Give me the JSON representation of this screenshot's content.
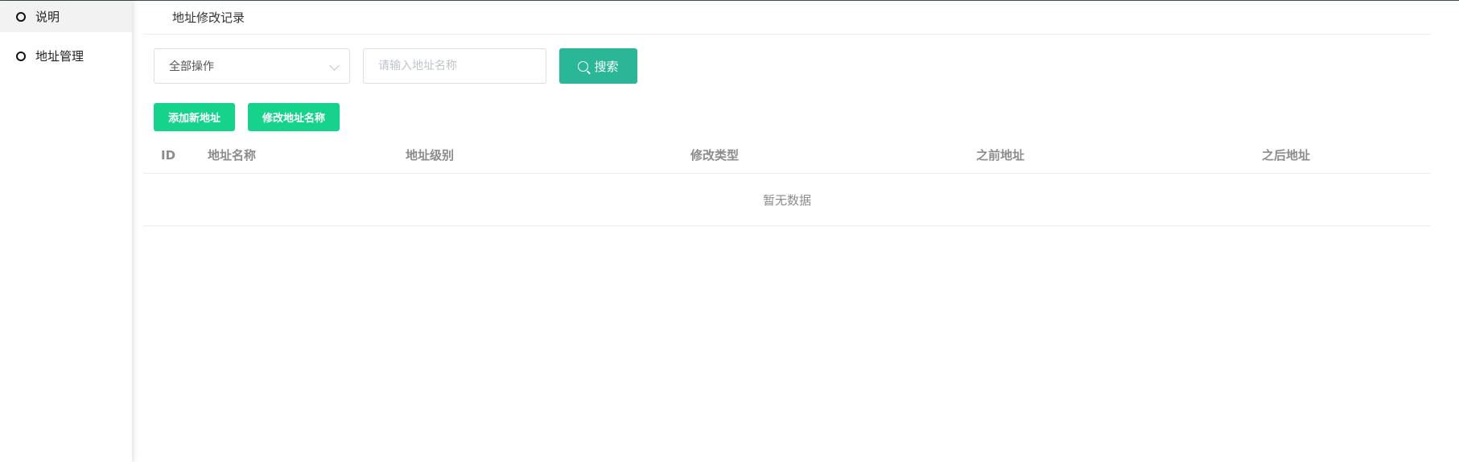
{
  "sidebar": {
    "items": [
      {
        "label": "说明",
        "active": true
      },
      {
        "label": "地址管理",
        "active": false
      }
    ]
  },
  "page": {
    "title": "地址修改记录"
  },
  "filters": {
    "operation_select": {
      "value": "全部操作"
    },
    "search": {
      "placeholder": "请输入地址名称",
      "value": ""
    },
    "search_button": {
      "label": "搜索",
      "icon": "search-icon"
    }
  },
  "actions": {
    "add_label": "添加新地址",
    "rename_label": "修改地址名称"
  },
  "table": {
    "columns": [
      "ID",
      "地址名称",
      "地址级别",
      "修改类型",
      "之前地址",
      "之后地址"
    ],
    "rows": [],
    "empty_text": "暂无数据"
  },
  "colors": {
    "search_button": "#29b797",
    "action_buttons": "#16d38c",
    "sidebar_active_bg": "#f2f2f2"
  }
}
